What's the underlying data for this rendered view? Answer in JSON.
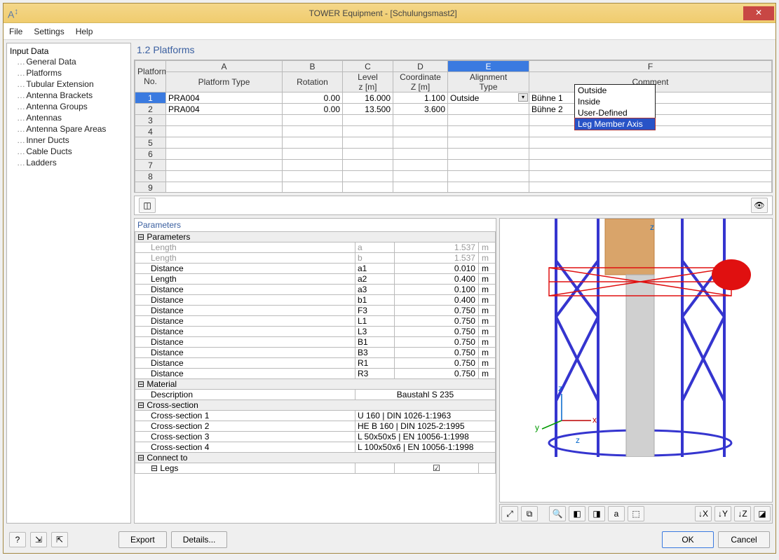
{
  "window": {
    "title": "TOWER Equipment - [Schulungsmast2]"
  },
  "menu": {
    "file": "File",
    "settings": "Settings",
    "help": "Help"
  },
  "tree": {
    "root": "Input Data",
    "items": [
      "General Data",
      "Platforms",
      "Tubular Extension",
      "Antenna Brackets",
      "Antenna Groups",
      "Antennas",
      "Antenna Spare Areas",
      "Inner Ducts",
      "Cable Ducts",
      "Ladders"
    ]
  },
  "section": "1.2 Platforms",
  "grid": {
    "letters": [
      "A",
      "B",
      "C",
      "D",
      "E",
      "F"
    ],
    "headers": {
      "no": "Platform\nNo.",
      "A": "Platform Type",
      "B": "Rotation",
      "C": "Level\nz [m]",
      "D": "Coordinate\nZ [m]",
      "E": "Alignment\nType",
      "F": "Comment"
    },
    "rows": [
      {
        "no": "1",
        "A": "PRA004",
        "B": "0.00",
        "C": "16.000",
        "D": "1.100",
        "E": "Outside",
        "F": "Bühne 1"
      },
      {
        "no": "2",
        "A": "PRA004",
        "B": "0.00",
        "C": "13.500",
        "D": "3.600",
        "E": "",
        "F": "Bühne 2"
      },
      {
        "no": "3"
      },
      {
        "no": "4"
      },
      {
        "no": "5"
      },
      {
        "no": "6"
      },
      {
        "no": "7"
      },
      {
        "no": "8"
      },
      {
        "no": "9"
      }
    ],
    "dropdown": [
      "Outside",
      "Inside",
      "User-Defined",
      "Leg Member Axis"
    ]
  },
  "params": {
    "title": "Parameters",
    "group_params": "Parameters",
    "rows": [
      {
        "n": "Length",
        "p": "a",
        "v": "1.537",
        "u": "m",
        "dim": true
      },
      {
        "n": "Length",
        "p": "b",
        "v": "1.537",
        "u": "m",
        "dim": true
      },
      {
        "n": "Distance",
        "p": "a1",
        "v": "0.010",
        "u": "m"
      },
      {
        "n": "Length",
        "p": "a2",
        "v": "0.400",
        "u": "m"
      },
      {
        "n": "Distance",
        "p": "a3",
        "v": "0.100",
        "u": "m"
      },
      {
        "n": "Distance",
        "p": "b1",
        "v": "0.400",
        "u": "m"
      },
      {
        "n": "Distance",
        "p": "F3",
        "v": "0.750",
        "u": "m"
      },
      {
        "n": "Distance",
        "p": "L1",
        "v": "0.750",
        "u": "m"
      },
      {
        "n": "Distance",
        "p": "L3",
        "v": "0.750",
        "u": "m"
      },
      {
        "n": "Distance",
        "p": "B1",
        "v": "0.750",
        "u": "m"
      },
      {
        "n": "Distance",
        "p": "B3",
        "v": "0.750",
        "u": "m"
      },
      {
        "n": "Distance",
        "p": "R1",
        "v": "0.750",
        "u": "m"
      },
      {
        "n": "Distance",
        "p": "R3",
        "v": "0.750",
        "u": "m"
      }
    ],
    "group_material": "Material",
    "material_desc_label": "Description",
    "material_desc_value": "Baustahl S 235",
    "group_cs": "Cross-section",
    "cs": [
      {
        "n": "Cross-section 1",
        "v": "U 160 | DIN 1026-1:1963"
      },
      {
        "n": "Cross-section 2",
        "v": "HE B 160 | DIN 1025-2:1995"
      },
      {
        "n": "Cross-section 3",
        "v": "L 50x50x5 | EN 10056-1:1998"
      },
      {
        "n": "Cross-section 4",
        "v": "L 100x50x6 | EN 10056-1:1998"
      }
    ],
    "group_connect": "Connect to",
    "legs": "Legs"
  },
  "preview_toolbar": {
    "zoom_ext": "⤢",
    "zoom_win": "⧉",
    "zoom": "🔍",
    "view1": "◧",
    "view2": "◨",
    "abc": "a",
    "xyz": "⬚",
    "vx": "↓X",
    "vy": "↓Y",
    "vz": "↓Z",
    "iso": "◪"
  },
  "footer": {
    "help": "?",
    "t1": "⇲",
    "t2": "⇱",
    "export": "Export",
    "details": "Details...",
    "ok": "OK",
    "cancel": "Cancel"
  },
  "eye": "👁"
}
